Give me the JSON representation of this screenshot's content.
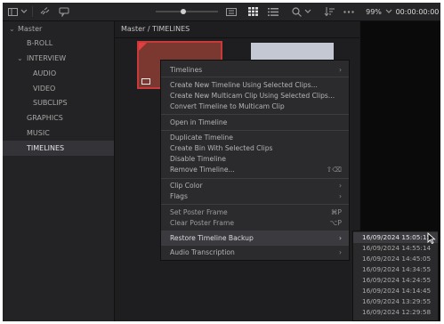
{
  "toolbar": {
    "zoom": "99%",
    "timecode": "00:00:00:00"
  },
  "sidebar": {
    "root_label": "Master",
    "items": [
      {
        "label": "B-ROLL"
      },
      {
        "label": "INTERVIEW"
      },
      {
        "label": "AUDIO"
      },
      {
        "label": "VIDEO"
      },
      {
        "label": "SUBCLIPS"
      },
      {
        "label": "GRAPHICS"
      },
      {
        "label": "MUSIC"
      },
      {
        "label": "TIMELINES"
      }
    ]
  },
  "breadcrumb": "Master / TIMELINES",
  "context_menu": {
    "items": [
      {
        "label": "Timelines",
        "submenu": true
      },
      {
        "label": "Create New Timeline Using Selected Clips..."
      },
      {
        "label": "Create New Multicam Clip Using Selected Clips..."
      },
      {
        "label": "Convert Timeline to Multicam Clip"
      },
      {
        "label": "Open in Timeline"
      },
      {
        "label": "Duplicate Timeline"
      },
      {
        "label": "Create Bin With Selected Clips"
      },
      {
        "label": "Disable Timeline"
      },
      {
        "label": "Remove Timeline...",
        "shortcut": "⇧⌫"
      },
      {
        "label": "Clip Color",
        "submenu": true
      },
      {
        "label": "Flags",
        "submenu": true
      },
      {
        "label": "Set Poster Frame",
        "shortcut": "⌘P"
      },
      {
        "label": "Clear Poster Frame",
        "shortcut": "⌥P"
      },
      {
        "label": "Restore Timeline Backup",
        "submenu": true
      },
      {
        "label": "Audio Transcription",
        "submenu": true
      }
    ]
  },
  "backup_submenu": {
    "items": [
      "16/09/2024 15:05:15",
      "16/09/2024 14:55:14",
      "16/09/2024 14:45:05",
      "16/09/2024 14:34:55",
      "16/09/2024 14:24:55",
      "16/09/2024 14:14:45",
      "16/09/2024 13:29:55",
      "16/09/2024 12:29:58"
    ]
  }
}
